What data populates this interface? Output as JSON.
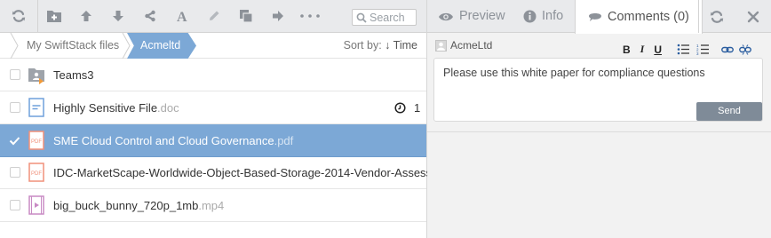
{
  "toolbar": {
    "search_placeholder": "Search",
    "more_label": "···",
    "buttons": [
      "refresh-icon",
      "new-folder-icon",
      "upload-icon",
      "download-icon",
      "share-icon",
      "rename-icon",
      "edit-icon",
      "copy-icon",
      "move-icon",
      "more-icon"
    ]
  },
  "breadcrumb": {
    "root": "My SwiftStack files",
    "current": "Acmeltd"
  },
  "sort": {
    "label": "Sort by:",
    "arrow": "↓",
    "field": "Time"
  },
  "files": [
    {
      "name": "Teams3",
      "ext": "",
      "type": "folder",
      "selected": false
    },
    {
      "name": "Highly Sensitive File",
      "ext": ".doc",
      "type": "doc",
      "selected": false,
      "versions": "1"
    },
    {
      "name": "SME Cloud Control and Cloud Governance",
      "ext": ".pdf",
      "type": "pdf",
      "selected": true
    },
    {
      "name": "IDC-MarketScape-Worldwide-Object-Based-Storage-2014-Vendor-Assess...",
      "ext": "",
      "type": "pdf",
      "selected": false
    },
    {
      "name": "big_buck_bunny_720p_1mb",
      "ext": ".mp4",
      "type": "video",
      "selected": false
    }
  ],
  "tabs": {
    "preview": "Preview",
    "info": "Info",
    "comments": "Comments (0)"
  },
  "comment": {
    "user": "AcmeLtd",
    "format_bold": "B",
    "format_italic": "I",
    "format_underline": "U",
    "text": "Please use this white paper for compliance questions",
    "send_label": "Send"
  },
  "colors": {
    "selection": "#7ca8d6",
    "toolbar_bg": "#e9eaec",
    "pdf_icon": "#f0907a",
    "doc_icon": "#6fa0dc",
    "video_icon": "#c88ac4"
  }
}
